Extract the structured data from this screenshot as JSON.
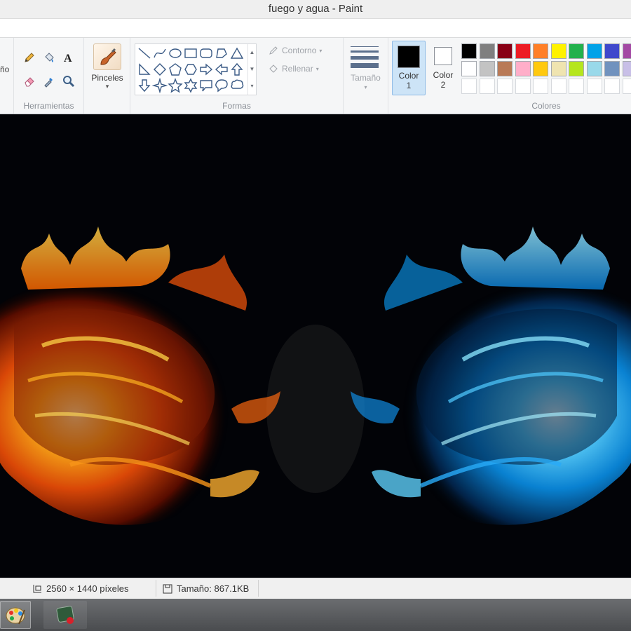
{
  "window": {
    "title": "fuego y agua - Paint"
  },
  "ribbon": {
    "partial_label": "ño",
    "tools": {
      "label": "Herramientas",
      "items": [
        "pencil-icon",
        "fill-icon",
        "text-icon",
        "eraser-icon",
        "color-picker-icon",
        "magnifier-icon"
      ]
    },
    "brushes": {
      "label": "Pinceles"
    },
    "shapes": {
      "label": "Formas",
      "outline_label": "Contorno",
      "fill_label": "Rellenar"
    },
    "size": {
      "label": "Tamaño"
    },
    "color1": {
      "label": "Color",
      "num": "1",
      "color": "#000000"
    },
    "color2": {
      "label": "Color",
      "num": "2",
      "color": "#ffffff"
    },
    "colors": {
      "label": "Colores",
      "row1": [
        "#000000",
        "#7f7f7f",
        "#880015",
        "#ed1c24",
        "#ff7f27",
        "#fff200",
        "#22b14c",
        "#00a2e8",
        "#3f48cc",
        "#a349a4"
      ],
      "row2": [
        "#ffffff",
        "#c3c3c3",
        "#b97a57",
        "#ffaec9",
        "#ffc90e",
        "#efe4b0",
        "#b5e61d",
        "#99d9ea",
        "#7092be",
        "#c8bfe7"
      ],
      "row3": [
        "#ffffff",
        "#ffffff",
        "#ffffff",
        "#ffffff",
        "#ffffff",
        "#ffffff",
        "#ffffff",
        "#ffffff",
        "#ffffff",
        "#ffffff"
      ]
    }
  },
  "status": {
    "dimensions": "2560 × 1440 píxeles",
    "size": "Tamaño: 867.1KB"
  },
  "taskbar": {
    "apps": [
      "paint-app-icon",
      "media-app-icon"
    ]
  }
}
